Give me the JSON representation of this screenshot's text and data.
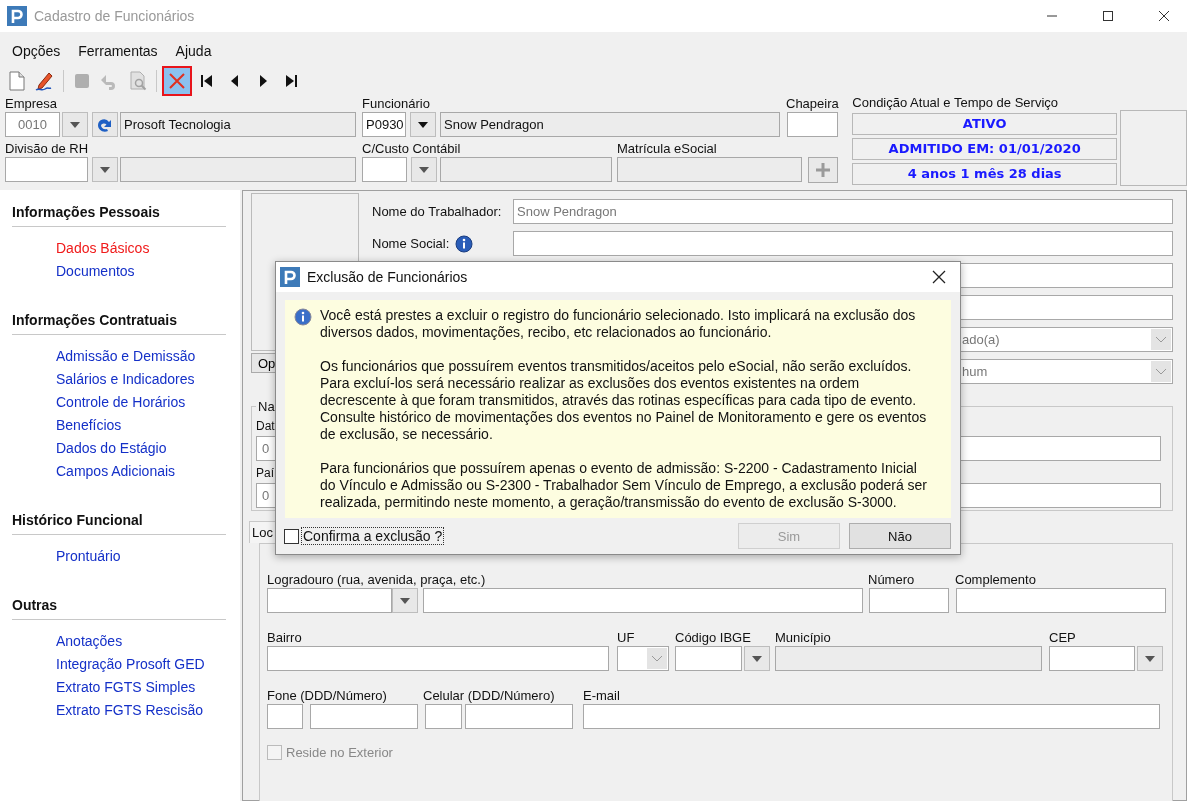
{
  "window": {
    "title": "Cadastro de Funcionários"
  },
  "menu": [
    "Opções",
    "Ferramentas",
    "Ajuda"
  ],
  "toolbar": [
    [
      {
        "kind": "new",
        "disabled": false,
        "selected": false
      },
      {
        "kind": "edit",
        "disabled": false,
        "selected": false
      }
    ],
    [
      {
        "kind": "stop",
        "disabled": true,
        "selected": false
      },
      {
        "kind": "undo",
        "disabled": true,
        "selected": false
      },
      {
        "kind": "preview",
        "disabled": true,
        "selected": false
      }
    ],
    [
      {
        "kind": "delete",
        "disabled": false,
        "selected": true
      },
      {
        "kind": "first",
        "disabled": false,
        "selected": false
      },
      {
        "kind": "prev",
        "disabled": false,
        "selected": false
      },
      {
        "kind": "next",
        "disabled": false,
        "selected": false
      },
      {
        "kind": "last",
        "disabled": false,
        "selected": false
      }
    ]
  ],
  "header": {
    "empresa": {
      "label": "Empresa",
      "code": {
        "value": "0010",
        "disabled": true
      },
      "name": "Prosoft Tecnologia"
    },
    "funcionario": {
      "label": "Funcionário",
      "code": {
        "value": "P0930",
        "disabled": false
      },
      "name": "Snow Pendragon"
    },
    "chapeira": {
      "label": "Chapeira"
    },
    "divisao_rh": {
      "label": "Divisão de RH"
    },
    "centro_custo": {
      "label": "C/Custo Contábil"
    },
    "matricula_esocial": {
      "label": "Matrícula eSocial"
    },
    "situacao": {
      "label": "Condição Atual e Tempo de Serviço",
      "lines": [
        "ATIVO",
        "ADMITIDO EM: 01/01/2020",
        "4 anos 1 mês 28 dias"
      ]
    }
  },
  "sidebar": [
    {
      "title": "Informações Pessoais",
      "items": [
        {
          "label": "Dados Básicos",
          "selected": true
        },
        {
          "label": "Documentos",
          "selected": false
        }
      ]
    },
    {
      "title": "Informações Contratuais",
      "items": [
        {
          "label": "Admissão e Demissão",
          "selected": false
        },
        {
          "label": "Salários e Indicadores",
          "selected": false
        },
        {
          "label": "Controle de Horários",
          "selected": false
        },
        {
          "label": "Benefícios",
          "selected": false
        },
        {
          "label": "Dados do Estágio",
          "selected": false
        },
        {
          "label": "Campos Adicionais",
          "selected": false
        }
      ]
    },
    {
      "title": "Histórico Funcional",
      "items": [
        {
          "label": "Prontuário",
          "selected": false
        }
      ]
    },
    {
      "title": "Outras",
      "items": [
        {
          "label": "Anotações",
          "selected": false
        },
        {
          "label": "Integração Prosoft GED",
          "selected": false
        },
        {
          "label": "Extrato FGTS Simples",
          "selected": false
        },
        {
          "label": "Extrato FGTS Rescisão",
          "selected": false
        }
      ]
    }
  ],
  "dados_basicos": {
    "photo_button": "Op",
    "nome_trabalhador": {
      "label": "Nome do Trabalhador:",
      "value": "Snow Pendragon",
      "disabled": true
    },
    "nome_social": {
      "label": "Nome Social:"
    },
    "select_1": "ado(a)",
    "select_2": "hum"
  },
  "nascimento": {
    "legend": "Na",
    "date_label": "Dat",
    "date_value": "0",
    "country_label": "Paí",
    "country_value": "0"
  },
  "endereco": {
    "tab": "Loc",
    "logradouro": "Logradouro (rua, avenida, praça, etc.)",
    "numero": "Número",
    "complemento": "Complemento",
    "bairro": "Bairro",
    "uf": "UF",
    "codigo_ibge": "Código IBGE",
    "municipio": "Município",
    "cep": "CEP",
    "fone": "Fone (DDD/Número)",
    "celular": "Celular (DDD/Número)",
    "email": "E-mail",
    "reside_exterior": {
      "label": "Reside no Exterior",
      "checked": false,
      "disabled": true
    }
  },
  "dialog": {
    "title": "Exclusão de Funcionários",
    "paragraphs": [
      "Você está prestes a excluir o registro do funcionário selecionado. Isto implicará na exclusão dos diversos dados, movimentações, recibo, etc relacionados ao funcionário.",
      "Os funcionários que possuírem eventos transmitidos/aceitos pelo eSocial, não serão excluídos. Para excluí-los será necessário realizar as exclusões dos eventos existentes na ordem decrescente à que foram transmitidos, através das rotinas específicas para cada tipo de evento. Consulte histórico de movimentações dos eventos no Painel de Monitoramento e gere os eventos de exclusão, se necessário.",
      "Para funcionários que possuírem apenas o evento de admissão: S-2200 - Cadastramento Inicial do Vínculo e Admissão ou S-2300 - Trabalhador Sem Vínculo de Emprego, a exclusão poderá ser realizada, permitindo neste momento, a geração/transmissão do evento de exclusão S-3000."
    ],
    "confirm": {
      "label": "Confirma a exclusão ?",
      "checked": false
    },
    "buttons": [
      {
        "label": "Sim",
        "disabled": true
      },
      {
        "label": "Não",
        "disabled": false
      }
    ]
  }
}
